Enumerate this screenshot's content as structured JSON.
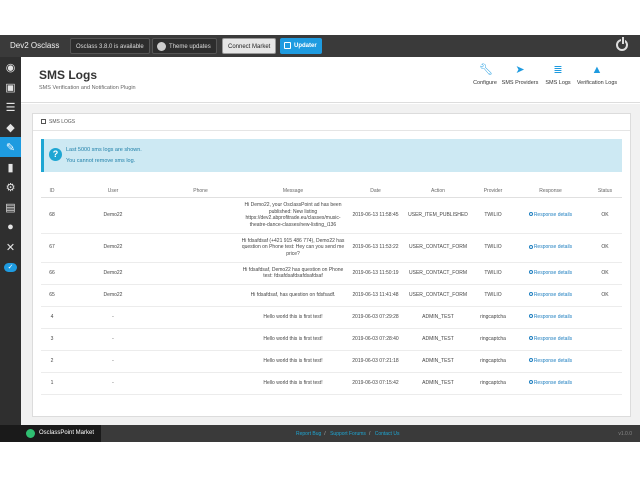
{
  "topbar": {
    "brand": "Dev2 Osclass",
    "version_notice": "Osclass 3.8.0 is available",
    "theme_updates": "Theme updates",
    "connect_market": "Connect Market",
    "updater": "Updater"
  },
  "header": {
    "title": "SMS Logs",
    "subtitle": "SMS Verification and Notification Plugin",
    "nav": [
      {
        "label": "Configure",
        "icon": "wrench-icon"
      },
      {
        "label": "SMS Providers",
        "icon": "paper-plane-icon"
      },
      {
        "label": "SMS Logs",
        "icon": "database-icon"
      },
      {
        "label": "Verification Logs",
        "icon": "user-badge-icon"
      }
    ]
  },
  "panel": {
    "title": "SMS LOGS",
    "alert_line1": "Last 5000 sms logs are shown.",
    "alert_line2": "You cannot remove sms log."
  },
  "table": {
    "columns": [
      "ID",
      "User",
      "Phone",
      "Message",
      "Date",
      "Action",
      "Provider",
      "Response",
      "Status"
    ],
    "rows": [
      {
        "id": "68",
        "user": "Demo22",
        "phone": "",
        "message": "Hi Demo22, your OsclassPoint ad has been published: New listing https://dev2.abprofitrade.eu/classes/music-theatre-dance-classes/new-listing_i136",
        "date": "2019-06-13 11:58:45",
        "action": "USER_ITEM_PUBLISHED",
        "provider": "TWILIO",
        "response": "Response details",
        "status": "OK"
      },
      {
        "id": "67",
        "user": "Demo22",
        "phone": "",
        "message": "Hi fdsafdsaf (+421 915 486 774), Demo22 has question on Phone test: Hey can you send me price?",
        "date": "2019-06-13 11:53:22",
        "action": "USER_CONTACT_FORM",
        "provider": "TWILIO",
        "response": "Response details",
        "status": "OK"
      },
      {
        "id": "66",
        "user": "Demo22",
        "phone": "",
        "message": "Hi fdsafdsaf, Demo22 has question on Phone test: fdsafdsafdsafdsafdsaf",
        "date": "2019-06-13 11:50:19",
        "action": "USER_CONTACT_FORM",
        "provider": "TWILIO",
        "response": "Response details",
        "status": "OK"
      },
      {
        "id": "65",
        "user": "Demo22",
        "phone": "",
        "message": "Hi fdsafdsaf, has question on fdsfsadf.",
        "date": "2019-06-13 11:41:48",
        "action": "USER_CONTACT_FORM",
        "provider": "TWILIO",
        "response": "Response details",
        "status": "OK"
      },
      {
        "id": "4",
        "user": "-",
        "phone": "",
        "message": "Hello world this is first test!",
        "date": "2019-06-03 07:29:28",
        "action": "ADMIN_TEST",
        "provider": "ringcaptcha",
        "response": "Response details",
        "status": ""
      },
      {
        "id": "3",
        "user": "-",
        "phone": "",
        "message": "Hello world this is first test!",
        "date": "2019-06-03 07:28:40",
        "action": "ADMIN_TEST",
        "provider": "ringcaptcha",
        "response": "Response details",
        "status": ""
      },
      {
        "id": "2",
        "user": "-",
        "phone": "",
        "message": "Hello world this is first test!",
        "date": "2019-06-03 07:21:18",
        "action": "ADMIN_TEST",
        "provider": "ringcaptcha",
        "response": "Response details",
        "status": ""
      },
      {
        "id": "1",
        "user": "-",
        "phone": "",
        "message": "Hello world this is first test!",
        "date": "2019-06-03 07:15:42",
        "action": "ADMIN_TEST",
        "provider": "ringcaptcha",
        "response": "Response details",
        "status": ""
      }
    ]
  },
  "footer": {
    "brand": "OsclassPoint Market",
    "report_bug": "Report Bug",
    "support_forums": "Support Forums",
    "contact_us": "Contact Us",
    "version": "v1.0.0"
  },
  "colors": {
    "accent": "#1e9be0",
    "topbar": "#3a3a3a",
    "sidebar": "#2f2f2f",
    "alert_bg": "#cde9f3"
  }
}
